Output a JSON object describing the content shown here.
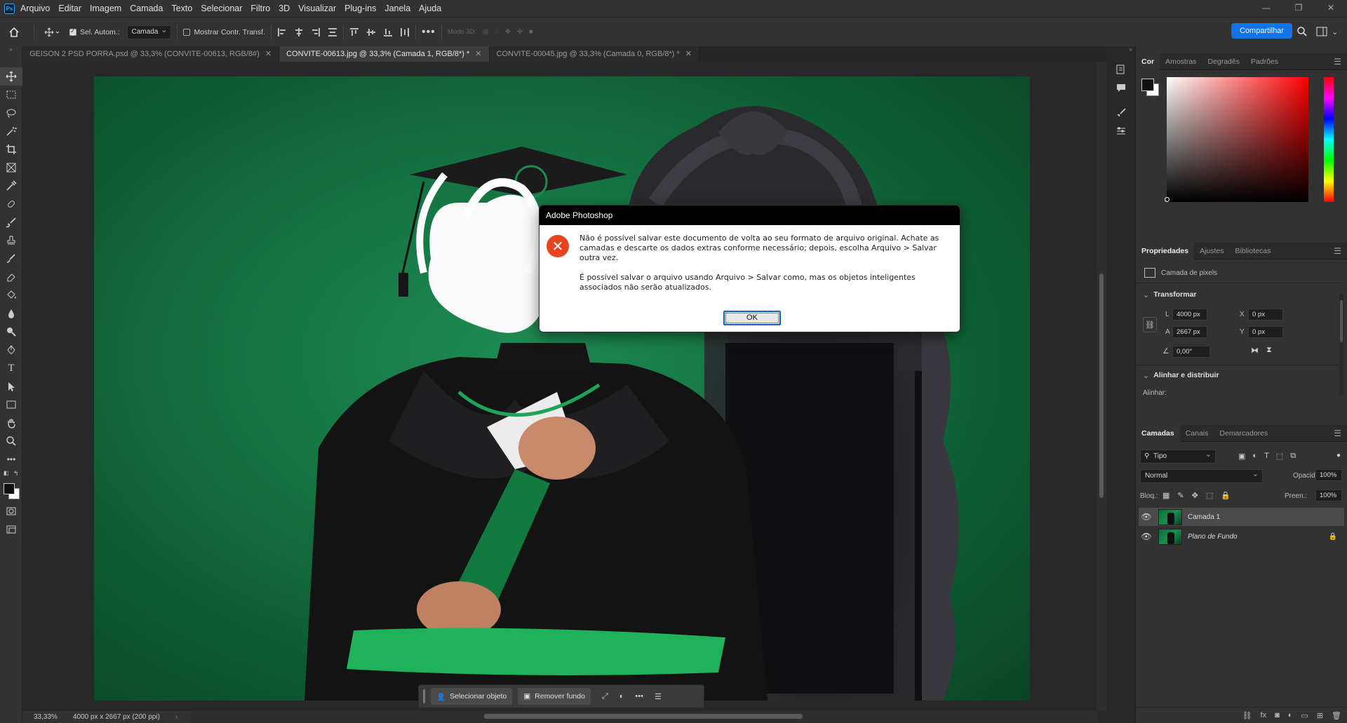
{
  "app": {
    "logo": "Ps"
  },
  "menu": [
    "Arquivo",
    "Editar",
    "Imagem",
    "Camada",
    "Texto",
    "Selecionar",
    "Filtro",
    "3D",
    "Visualizar",
    "Plug-ins",
    "Janela",
    "Ajuda"
  ],
  "options": {
    "auto_select_label": "Sel. Autom.:",
    "auto_select_value": "Camada",
    "show_transform_label": "Mostrar Contr. Transf.",
    "mode3d_label": "Modo 3D:",
    "share_label": "Compartilhar"
  },
  "tabs": [
    {
      "label": "GEISON 2 PSD PORRA.psd @ 33,3% (CONVITE-00613, RGB/8#)",
      "active": false
    },
    {
      "label": "CONVITE-00613.jpg @ 33,3% (Camada 1, RGB/8*) *",
      "active": true
    },
    {
      "label": "CONVITE-00045.jpg @ 33,3% (Camada 0, RGB/8*) *",
      "active": false
    }
  ],
  "status": {
    "zoom": "33,33%",
    "doc_info": "4000 px x 2667 px (200 ppi)"
  },
  "contextual_bar": {
    "select_subject": "Selecionar objeto",
    "remove_bg": "Remover fundo"
  },
  "dialog": {
    "title": "Adobe Photoshop",
    "message1": "Não é possível salvar este documento de volta ao seu formato de arquivo original. Achate as camadas e descarte os dados extras conforme necessário; depois, escolha Arquivo > Salvar outra vez.",
    "message2": "É possível salvar o arquivo usando Arquivo > Salvar como, mas os objetos inteligentes associados não serão atualizados.",
    "ok_label": "OK"
  },
  "color_panel": {
    "tabs": [
      "Cor",
      "Amostras",
      "Degradês",
      "Padrões"
    ],
    "active": "Cor"
  },
  "properties_panel": {
    "tabs": [
      "Propriedades",
      "Ajustes",
      "Bibliotecas"
    ],
    "layer_type": "Camada de pixels",
    "transform_label": "Transformar",
    "w_label": "L",
    "w_value": "4000 px",
    "h_label": "A",
    "h_value": "2667 px",
    "x_label": "X",
    "x_value": "0 px",
    "y_label": "Y",
    "y_value": "0 px",
    "angle_value": "0,00°",
    "align_label": "Alinhar e distribuir",
    "align_sub": "Alinhar:"
  },
  "layers_panel": {
    "tabs": [
      "Camadas",
      "Canais",
      "Demarcadores"
    ],
    "filter_value": "Tipo",
    "blend_mode": "Normal",
    "opacity_label": "Opacidade:",
    "opacity_value": "100%",
    "lock_label": "Bloq.:",
    "fill_label": "Preen.:",
    "fill_value": "100%",
    "layers": [
      {
        "name": "Camada 1",
        "selected": true
      },
      {
        "name": "Plano de Fundo",
        "selected": false,
        "locked": true
      }
    ]
  },
  "colors": {
    "accent": "#1473e6",
    "error_icon": "#e6451e"
  }
}
